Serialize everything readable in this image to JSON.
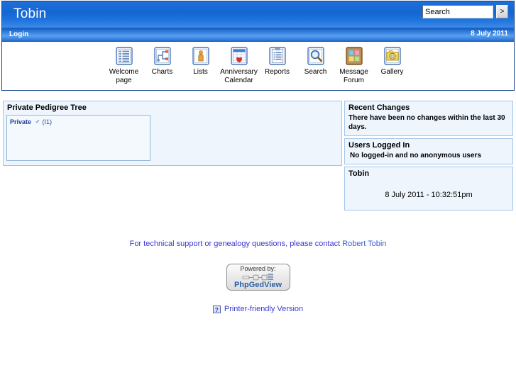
{
  "header": {
    "site_title": "Tobin",
    "search": {
      "value": "Search",
      "placeholder": "Search",
      "go_label": ">"
    }
  },
  "loginbar": {
    "login_label": "Login",
    "date": "8 July 2011"
  },
  "nav": {
    "items": [
      {
        "label": "Welcome page",
        "icon": "list-lines-icon"
      },
      {
        "label": "Charts",
        "icon": "chart-tree-icon"
      },
      {
        "label": "Lists",
        "icon": "person-list-icon"
      },
      {
        "label": "Anniversary Calendar",
        "icon": "calendar-heart-icon"
      },
      {
        "label": "Reports",
        "icon": "report-clipboard-icon"
      },
      {
        "label": "Search",
        "icon": "magnifier-icon"
      },
      {
        "label": "Message Forum",
        "icon": "corkboard-notes-icon"
      },
      {
        "label": "Gallery",
        "icon": "camera-icon"
      }
    ]
  },
  "main": {
    "pedigree": {
      "title": "Private Pedigree Tree",
      "person": {
        "name": "Private",
        "sex_symbol": "♂",
        "id": "(I1)"
      }
    }
  },
  "sidebar": {
    "recent_changes": {
      "title": "Recent Changes",
      "text": "There have been no changes within the last 30 days."
    },
    "users_logged_in": {
      "title": "Users Logged In",
      "text": "No logged-in and no anonymous users"
    },
    "clock": {
      "title": "Tobin",
      "time": "8 July 2011 - 10:32:51pm"
    }
  },
  "footer": {
    "support_text": "For technical support or genealogy questions, please contact ",
    "support_contact": "Robert Tobin",
    "badge": {
      "powered_by": "Powered by:",
      "product": "PhpGedView"
    },
    "printer_link": "Printer-friendly Version",
    "printer_icon_glyph": "?"
  },
  "colors": {
    "header_blue": "#1566d2",
    "border_blue": "#17458f",
    "block_border": "#a3c6ea",
    "block_bg": "#eef5fd",
    "link_blue": "#3a3ad0",
    "name_blue": "#22409a"
  }
}
